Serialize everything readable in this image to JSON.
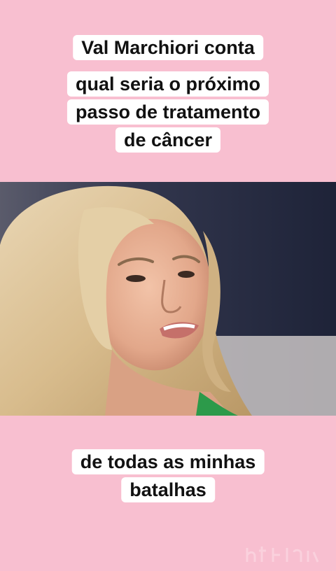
{
  "caption_top": {
    "lines": [
      "Val Marchiori conta",
      "qual seria o próximo",
      "passo de tratamento",
      "de câncer"
    ]
  },
  "caption_bottom": {
    "lines": [
      "de todas as minhas",
      "batalhas"
    ]
  },
  "colors": {
    "background": "#f8bfd0",
    "caption_bg": "#ffffff",
    "caption_text": "#111111"
  }
}
